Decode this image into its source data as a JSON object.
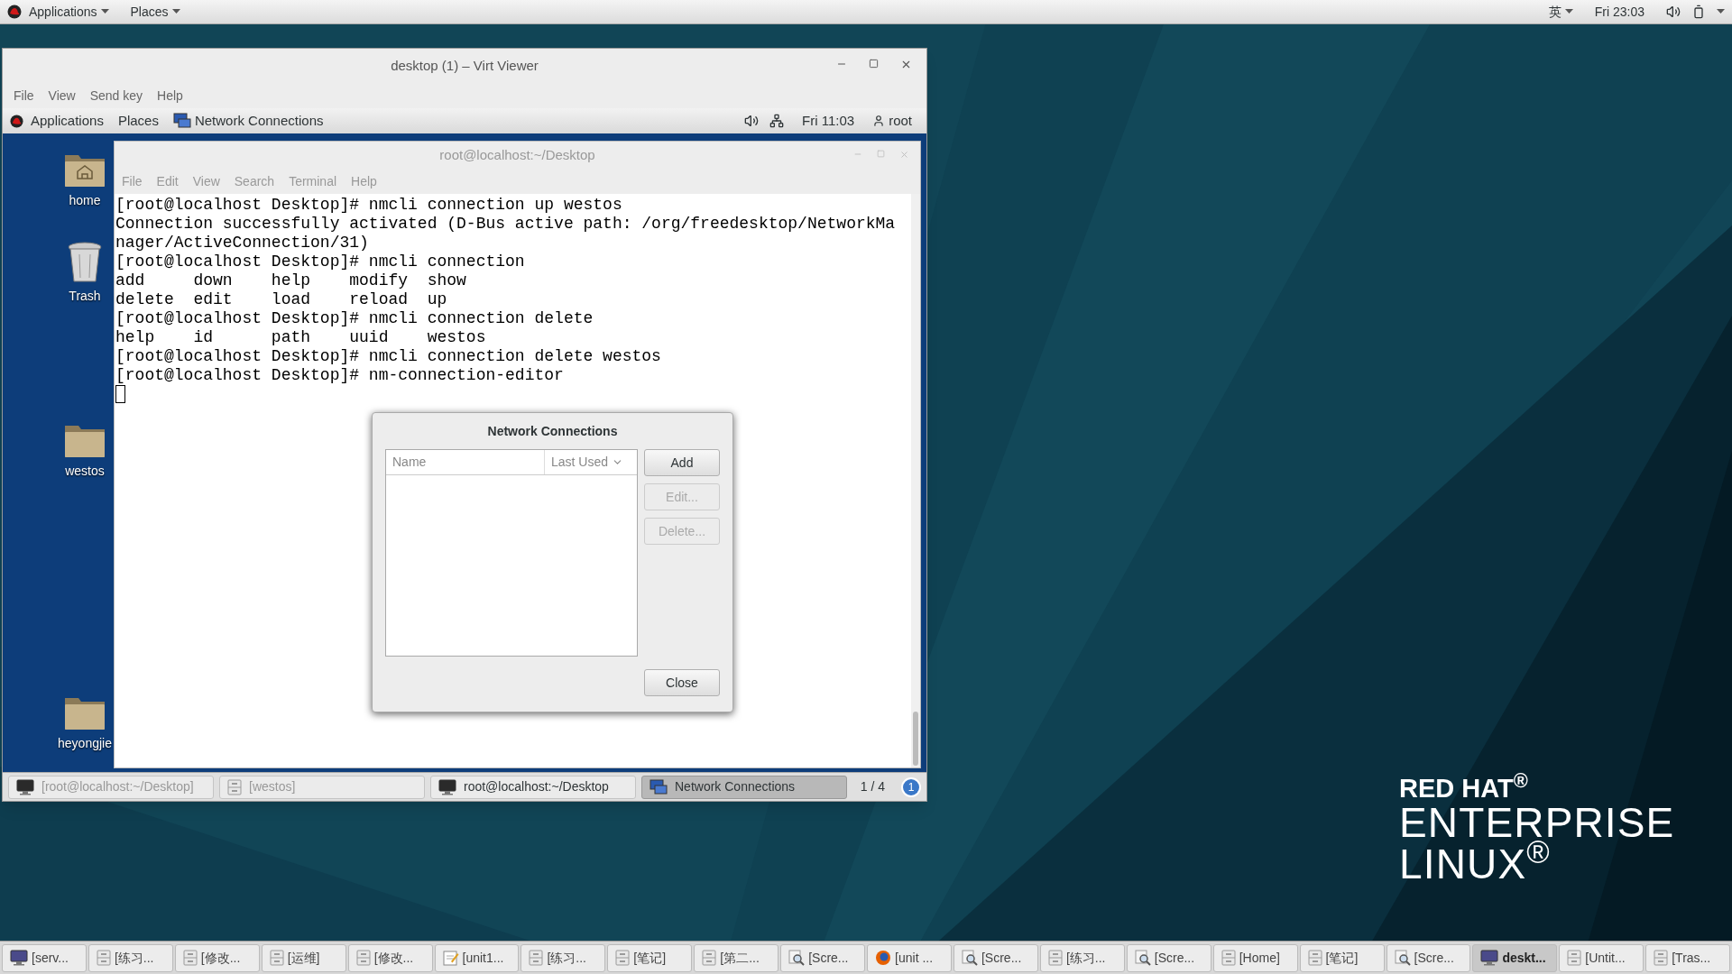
{
  "top_bar": {
    "menus": [
      "Applications",
      "Places"
    ],
    "input_method": "英",
    "clock": "Fri 23:03"
  },
  "viewer": {
    "title": "desktop (1) – Virt Viewer",
    "menus": [
      "File",
      "View",
      "Send key",
      "Help"
    ],
    "guest": {
      "top_bar": {
        "menus": [
          "Applications",
          "Places"
        ],
        "app": "Network Connections",
        "clock": "Fri 11:03",
        "user": "root"
      },
      "desktop_icons": [
        {
          "label": "home",
          "kind": "home"
        },
        {
          "label": "Trash",
          "kind": "trash"
        },
        {
          "label": "westos",
          "kind": "folder"
        },
        {
          "label": "heyongjie",
          "kind": "folder"
        }
      ],
      "terminal": {
        "title": "root@localhost:~/Desktop",
        "menus": [
          "File",
          "Edit",
          "View",
          "Search",
          "Terminal",
          "Help"
        ],
        "lines": [
          "[root@localhost Desktop]# nmcli connection up westos",
          "Connection successfully activated (D-Bus active path: /org/freedesktop/NetworkMa",
          "nager/ActiveConnection/31)",
          "[root@localhost Desktop]# nmcli connection",
          "add     down    help    modify  show",
          "delete  edit    load    reload  up",
          "[root@localhost Desktop]# nmcli connection delete",
          "help    id      path    uuid    westos",
          "[root@localhost Desktop]# nmcli connection delete westos",
          "[root@localhost Desktop]# nm-connection-editor"
        ]
      },
      "dialog": {
        "title": "Network Connections",
        "columns": [
          "Name",
          "Last Used"
        ],
        "buttons": [
          {
            "label": "Add",
            "disabled": false
          },
          {
            "label": "Edit...",
            "disabled": true
          },
          {
            "label": "Delete...",
            "disabled": true
          }
        ],
        "close": "Close"
      },
      "taskbar": {
        "items": [
          {
            "label": "[root@localhost:~/Desktop]",
            "kind": "terminal",
            "minimized": true,
            "selected": false
          },
          {
            "label": "[westos]",
            "kind": "cabinet",
            "minimized": true,
            "selected": false
          },
          {
            "label": "root@localhost:~/Desktop",
            "kind": "terminal",
            "minimized": false,
            "selected": false
          },
          {
            "label": "Network Connections",
            "kind": "network",
            "minimized": false,
            "selected": true
          }
        ],
        "workspace": "1 / 4",
        "badge": "1"
      }
    }
  },
  "taskbar": {
    "items": [
      {
        "label": "[serv...",
        "kind": "monitor",
        "selected": false
      },
      {
        "label": "[练习...",
        "kind": "cabinet",
        "selected": false
      },
      {
        "label": "[修改...",
        "kind": "cabinet",
        "selected": false
      },
      {
        "label": "[运维]",
        "kind": "cabinet",
        "selected": false
      },
      {
        "label": "[修改...",
        "kind": "cabinet",
        "selected": false
      },
      {
        "label": "[unit1...",
        "kind": "editor",
        "selected": false
      },
      {
        "label": "[练习...",
        "kind": "cabinet",
        "selected": false
      },
      {
        "label": "[笔记]",
        "kind": "cabinet",
        "selected": false
      },
      {
        "label": "[第二...",
        "kind": "cabinet",
        "selected": false
      },
      {
        "label": "[Scre...",
        "kind": "viewer",
        "selected": false
      },
      {
        "label": "[unit ...",
        "kind": "browser",
        "selected": false
      },
      {
        "label": "[Scre...",
        "kind": "viewer",
        "selected": false
      },
      {
        "label": "[练习...",
        "kind": "cabinet",
        "selected": false
      },
      {
        "label": "[Scre...",
        "kind": "viewer",
        "selected": false
      },
      {
        "label": "[Home]",
        "kind": "cabinet",
        "selected": false
      },
      {
        "label": "[笔记]",
        "kind": "cabinet",
        "selected": false
      },
      {
        "label": "[Scre...",
        "kind": "viewer",
        "selected": false
      },
      {
        "label": "deskt...",
        "kind": "monitor",
        "selected": true
      },
      {
        "label": "[Untit...",
        "kind": "cabinet",
        "selected": false
      },
      {
        "label": "[Tras...",
        "kind": "cabinet",
        "selected": false
      }
    ]
  },
  "logo": {
    "brand": "RED HAT$^{®}$",
    "product": "ENTERPRISE",
    "edition": "LINUX$^{®}$"
  }
}
